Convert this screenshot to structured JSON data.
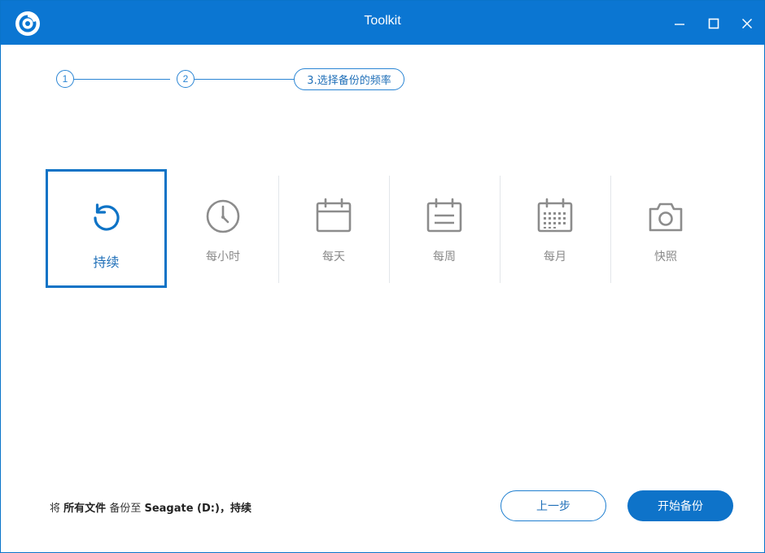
{
  "window": {
    "title": "Toolkit"
  },
  "stepper": {
    "step1": "1",
    "step2": "2",
    "step3": "3.选择备份的频率"
  },
  "options": [
    {
      "label": "持续",
      "icon": "continuous-icon",
      "selected": true
    },
    {
      "label": "每小时",
      "icon": "clock-icon",
      "selected": false
    },
    {
      "label": "每天",
      "icon": "calendar-day-icon",
      "selected": false
    },
    {
      "label": "每周",
      "icon": "calendar-week-icon",
      "selected": false
    },
    {
      "label": "每月",
      "icon": "calendar-month-icon",
      "selected": false
    },
    {
      "label": "快照",
      "icon": "camera-icon",
      "selected": false
    }
  ],
  "summary": {
    "prefix": "将",
    "source": "所有文件",
    "middle": "备份至",
    "target": "Seagate (D:)",
    "comma": "，",
    "frequency": "持续"
  },
  "buttons": {
    "back": "上一步",
    "start": "开始备份"
  },
  "colors": {
    "accent": "#0b76d2",
    "inactive_icon": "#8c8c8c"
  }
}
